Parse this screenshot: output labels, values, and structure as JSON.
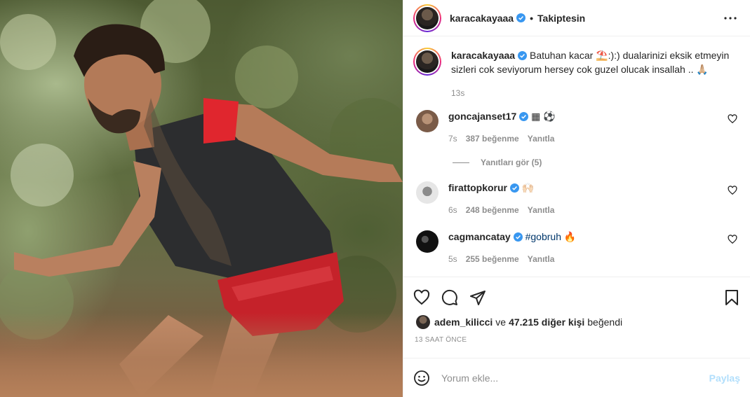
{
  "post": {
    "author": "karacakayaaa",
    "follow_state": "Takiptesin",
    "separator": "•",
    "verified_icon": "verified-badge-icon",
    "more_icon": "more-options-icon"
  },
  "caption": {
    "username": "karacakayaaa",
    "text": "Batuhan kacar ⛱️:):) dualarinizi eksik etmeyin sizleri cok seviyorum hersey cok guzel olucak insallah .. 🙏🏼",
    "time": "13s"
  },
  "comments": [
    {
      "username": "goncajanset17",
      "text": "▦ ⚽",
      "time": "7s",
      "likes": "387 beğenme",
      "reply": "Yanıtla",
      "avatar_color": "#7a5b48"
    },
    {
      "username": "firattopkorur",
      "text": "🙌🏻",
      "time": "6s",
      "likes": "248 beğenme",
      "reply": "Yanıtla",
      "avatar_color": "#cfcfcf"
    },
    {
      "username": "cagmancatay",
      "text": "🔥",
      "hashtag": "#gobruh",
      "time": "5s",
      "likes": "255 beğenme",
      "reply": "Yanıtla",
      "avatar_color": "#111111"
    }
  ],
  "view_replies": "Yanıtları gör (5)",
  "likes": {
    "user": "adem_kilicci",
    "conj": "ve",
    "others": "47.215 diğer kişi",
    "suffix": "beğendi"
  },
  "timestamp": "13 SAAT ÖNCE",
  "add_comment": {
    "placeholder": "Yorum ekle...",
    "share": "Paylaş"
  },
  "colors": {
    "verified": "#3897f0",
    "link": "#00376b",
    "muted": "#8e8e8e",
    "share_disabled": "#b2dffc"
  }
}
